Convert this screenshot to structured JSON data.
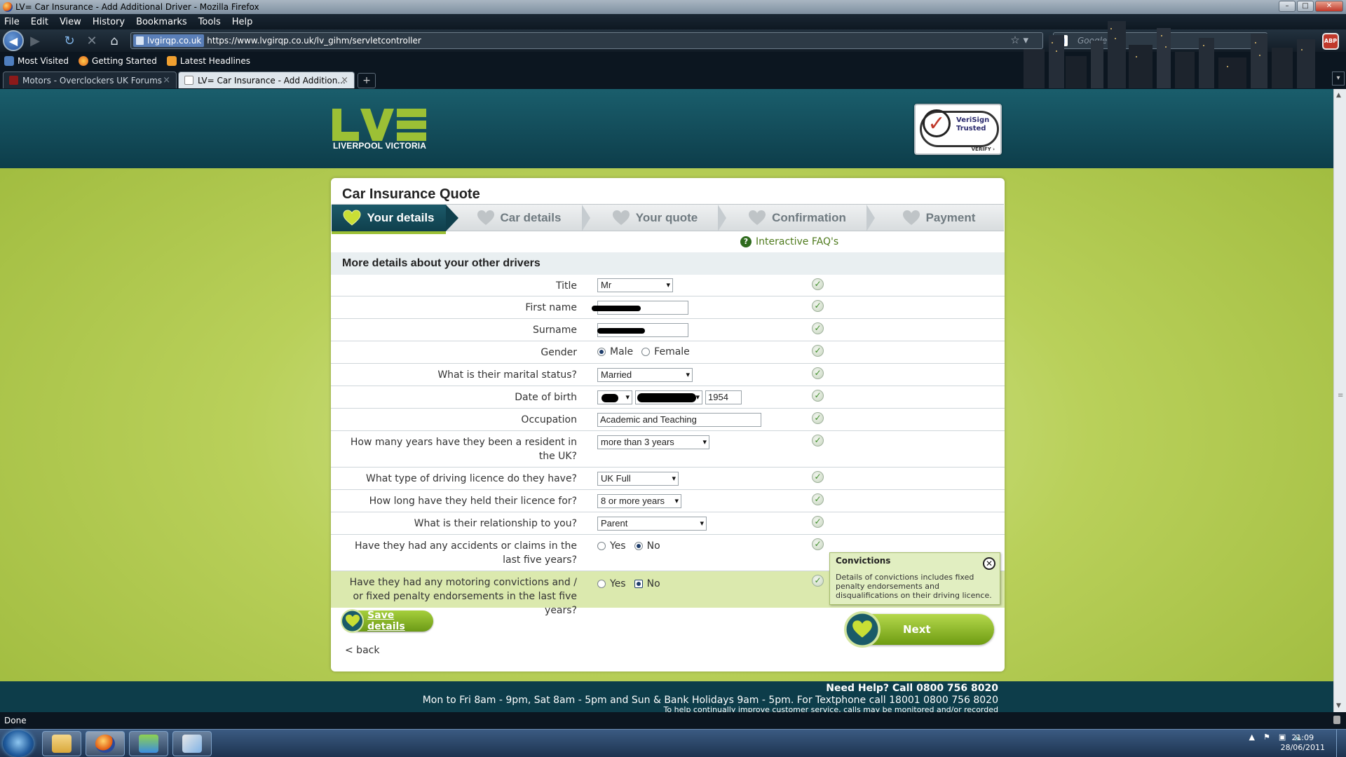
{
  "window": {
    "title": "LV= Car Insurance - Add Additional Driver - Mozilla Firefox"
  },
  "menu": [
    "File",
    "Edit",
    "View",
    "History",
    "Bookmarks",
    "Tools",
    "Help"
  ],
  "address": {
    "site_identity": "lvgirqp.co.uk",
    "url": "https://www.lvgirqp.co.uk/lv_gihm/servletcontroller"
  },
  "search": {
    "placeholder": "Google"
  },
  "bookmarks": [
    "Most Visited",
    "Getting Started",
    "Latest Headlines"
  ],
  "tabs": [
    {
      "label": "Motors - Overclockers UK Forums",
      "active": false
    },
    {
      "label": "LV= Car Insurance - Add Addition...",
      "active": true
    }
  ],
  "page": {
    "logo_text": "LIVERPOOL VICTORIA",
    "verisign": {
      "line1": "VeriSign",
      "line2": "Trusted",
      "verify": "VERIFY ›"
    },
    "quote_title": "Car Insurance Quote",
    "steps": [
      "Your details",
      "Car details",
      "Your quote",
      "Confirmation",
      "Payment"
    ],
    "faq_link": "Interactive FAQ's",
    "section_title": "More details about your other drivers",
    "fields": {
      "title": {
        "label": "Title",
        "value": "Mr"
      },
      "first_name": {
        "label": "First name"
      },
      "surname": {
        "label": "Surname"
      },
      "gender": {
        "label": "Gender",
        "options": [
          "Male",
          "Female"
        ],
        "selected": "Male"
      },
      "marital": {
        "label": "What is their marital status?",
        "value": "Married"
      },
      "dob": {
        "label": "Date of birth",
        "year": "1954"
      },
      "occupation": {
        "label": "Occupation",
        "value": "Academic and Teaching"
      },
      "resident": {
        "label": "How many years have they been a resident in the UK?",
        "value": "more than 3 years"
      },
      "licence_type": {
        "label": "What type of driving licence do they have?",
        "value": "UK Full"
      },
      "licence_held": {
        "label": "How long have they held their licence for?",
        "value": "8 or more years"
      },
      "relationship": {
        "label": "What is their relationship to you?",
        "value": "Parent"
      },
      "accidents": {
        "label": "Have they had any accidents or claims in the last five years?",
        "options": [
          "Yes",
          "No"
        ],
        "selected": "No"
      },
      "convictions": {
        "label": "Have they had any motoring convictions and / or fixed penalty endorsements in the last five years?",
        "options": [
          "Yes",
          "No"
        ],
        "selected": "No"
      }
    },
    "tooltip": {
      "title": "Convictions",
      "body": "Details of convictions includes fixed penalty endorsements and disqualifications on their driving licence."
    },
    "save_label": "Save details",
    "next_label": "Next",
    "back_label": "< back",
    "footer": {
      "help": "Need Help? Call 0800 756 8020",
      "hours": "Mon to Fri 8am - 9pm, Sat 8am - 5pm and Sun & Bank Holidays 9am - 5pm. For Textphone call 18001 0800 756 8020",
      "notice": "To help continually improve customer service, calls may be monitored and/or recorded"
    }
  },
  "status": "Done",
  "clock": {
    "time": "21:09",
    "date": "28/06/2011"
  },
  "colors": {
    "brand_teal": "#0d3d4a",
    "brand_green": "#9cc035",
    "page_bg": "#b9d05a"
  }
}
